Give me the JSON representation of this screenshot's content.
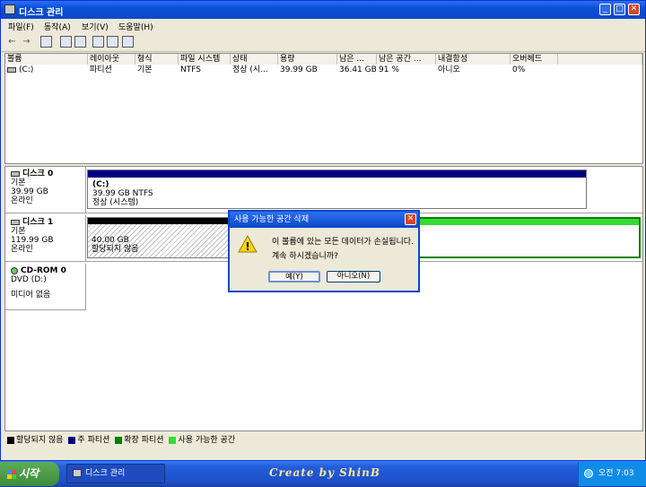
{
  "window": {
    "title": "디스크 관리",
    "min": "_",
    "max": "□",
    "close": "✕"
  },
  "menu": [
    "파일(F)",
    "동작(A)",
    "보기(V)",
    "도움말(H)"
  ],
  "toolbar": {
    "back": "←",
    "forward": "→"
  },
  "columns": [
    "볼륨",
    "레이아웃",
    "형식",
    "파일 시스템",
    "상태",
    "용량",
    "남은 ...",
    "남은 공간 ...",
    "내결함성",
    "오버헤드"
  ],
  "volume_row": [
    "(C:)",
    "파티션",
    "기본",
    "NTFS",
    "정상 (시...",
    "39.99 GB",
    "36.41 GB",
    "91 %",
    "아니오",
    "0%"
  ],
  "disks": [
    {
      "name": "디스크 0",
      "type": "기본",
      "size": "39.99 GB",
      "status": "온라인",
      "partition": {
        "label": "(C:)",
        "detail": "39.99 GB NTFS",
        "state": "정상 (시스템)"
      }
    },
    {
      "name": "디스크 1",
      "type": "기본",
      "size": "119.99 GB",
      "status": "온라인",
      "partition": {
        "size": "40.00 GB",
        "state": "할당되지 않음"
      }
    },
    {
      "name": "CD-ROM 0",
      "type": "DVD (D:)",
      "status": "미디어 없음"
    }
  ],
  "legend": [
    {
      "label": "할당되지 않음",
      "color": "#000000"
    },
    {
      "label": "주 파티션",
      "color": "#000080"
    },
    {
      "label": "확장 파티션",
      "color": "#008000"
    },
    {
      "label": "사용 가능한 공간",
      "color": "#33dd33"
    }
  ],
  "dialog": {
    "title": "사용 가능한 공간 삭제",
    "message": "이 볼륨에 있는 모든 데이터가 손실됩니다.",
    "question": "계속 하시겠습니까?",
    "yes": "예(Y)",
    "no": "아니오(N)",
    "close": "✕",
    "warning": "!"
  },
  "taskbar": {
    "start": "시작",
    "task": "디스크 관리",
    "banner": "Create by ShinB",
    "clock": "오전 7:03"
  }
}
